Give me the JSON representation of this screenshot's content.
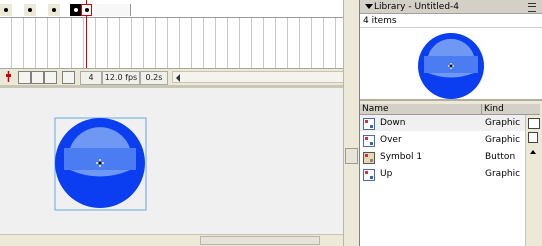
{
  "timeline": {
    "current_frame": "4",
    "fps": "12.0 fps",
    "elapsed": "0.2s"
  },
  "library": {
    "title": "Library - Untitled-4",
    "item_count": "4 items",
    "columns": {
      "name": "Name",
      "kind": "Kind"
    },
    "items": [
      {
        "name": "Down",
        "kind": "Graphic",
        "icon": "graphic-symbol-icon",
        "selected": true
      },
      {
        "name": "Over",
        "kind": "Graphic",
        "icon": "graphic-symbol-icon",
        "selected": false
      },
      {
        "name": "Symbol 1",
        "kind": "Button",
        "icon": "button-symbol-icon",
        "selected": false
      },
      {
        "name": "Up",
        "kind": "Graphic",
        "icon": "graphic-symbol-icon",
        "selected": false
      }
    ]
  },
  "colors": {
    "circle_outer": "#0a3ef0",
    "circle_inner": "#4c7cf2",
    "circle_highlight": "#6f98f5",
    "playhead": "#cc0000"
  }
}
